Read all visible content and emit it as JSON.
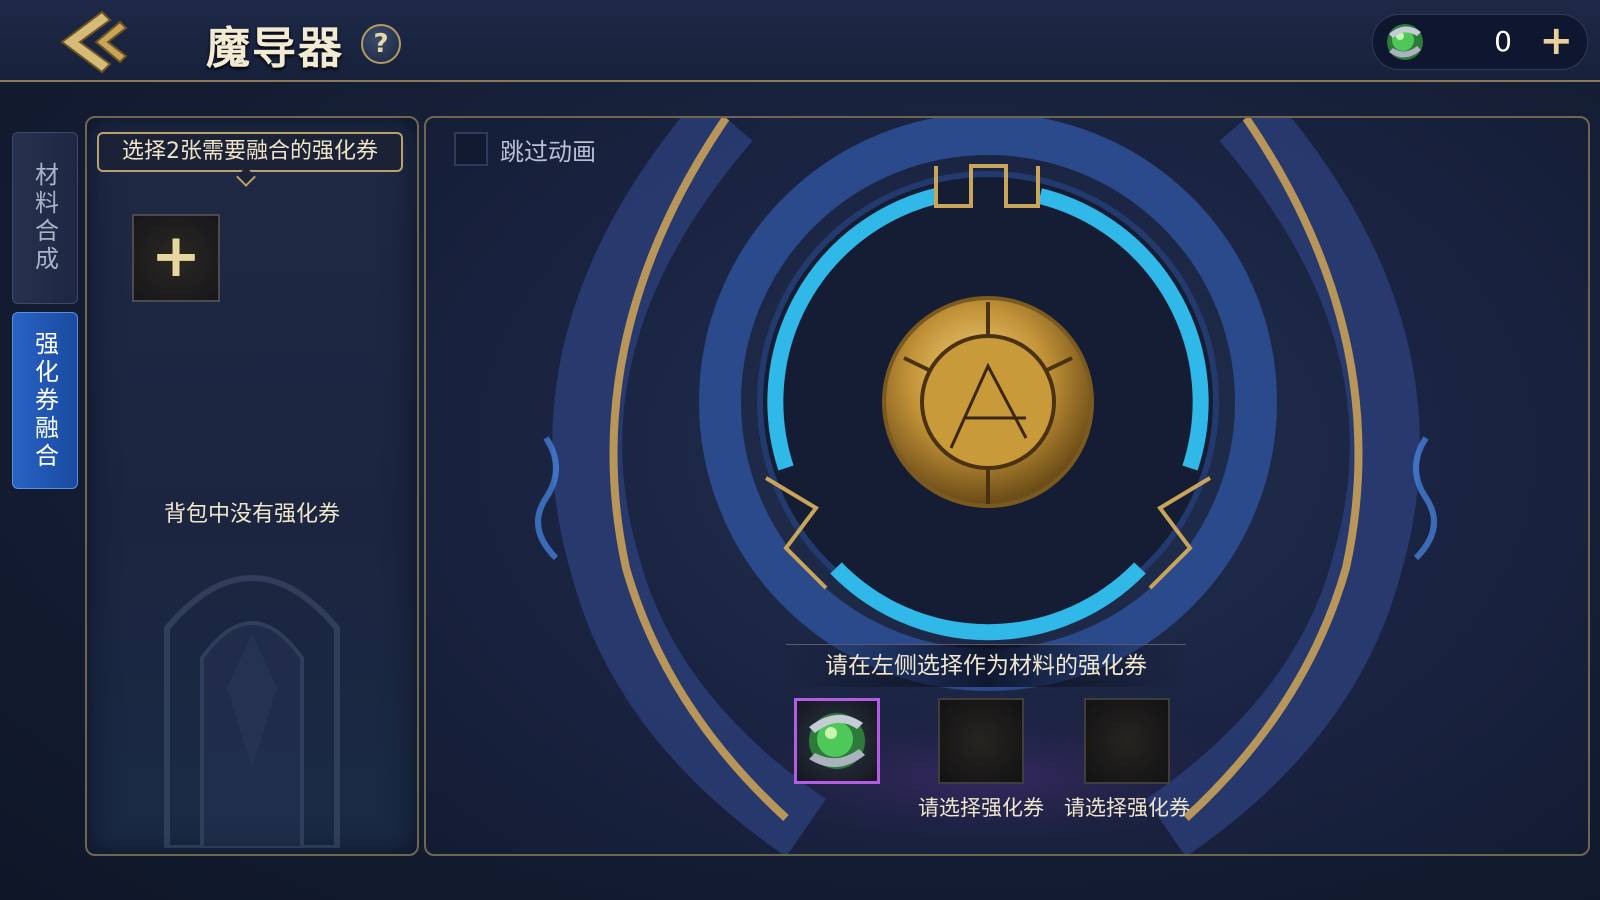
{
  "header": {
    "title": "魔导器",
    "help_label": "?",
    "currency_amount": "0",
    "add_label": "+"
  },
  "tabs": [
    {
      "label": "材料合成",
      "active": false
    },
    {
      "label": "强化券融合",
      "active": true
    }
  ],
  "left_panel": {
    "banner": "选择2张需要融合的强化券",
    "add_label": "+",
    "empty_message": "背包中没有强化券"
  },
  "main": {
    "skip_animation_label": "跳过动画",
    "skip_animation_checked": false,
    "instruction": "请在左侧选择作为材料的强化券",
    "slots": [
      {
        "label": "",
        "filled": true,
        "icon": "green-gem-icon"
      },
      {
        "label": "请选择强化券",
        "filled": false
      },
      {
        "label": "请选择强化券",
        "filled": false
      }
    ]
  },
  "colors": {
    "accent_gold": "#c9a55a",
    "glow_blue": "#2fb8e8",
    "active_tab": "#2863c4",
    "selected_slot": "#b55ce6"
  }
}
